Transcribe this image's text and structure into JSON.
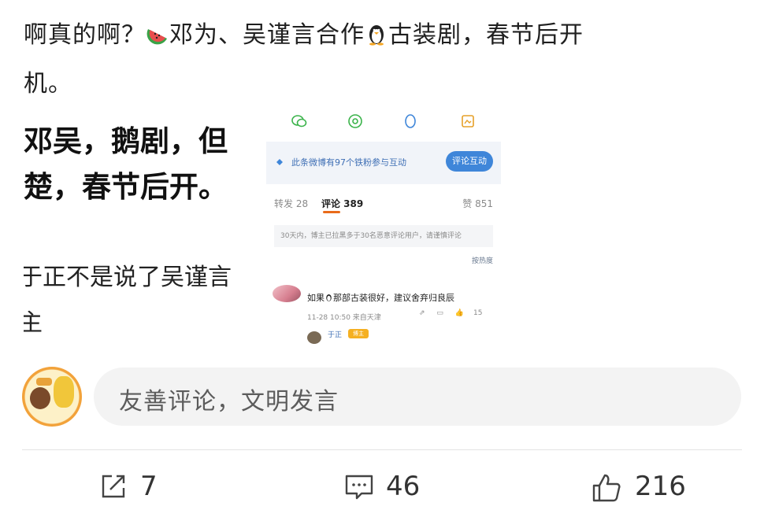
{
  "post": {
    "headline_part1": "啊真的啊？",
    "headline_part2": "邓为、吴谨言合作",
    "headline_part3": "古装剧，春节后开",
    "headline_part4": "机。"
  },
  "image_left": {
    "line1": "邓吴，鹅剧，但",
    "line2": "楚，春节后开。",
    "line3": "于正不是说了吴谨言",
    "line4": "主"
  },
  "image_right": {
    "interaction_text": "此条微博有97个铁粉参与互动",
    "interaction_button": "评论互动",
    "tab_repost": "转发 28",
    "tab_comment": "评论 389",
    "tab_like": "赞 851",
    "notice": "30天内，博主已拉黑多于30名恶意评论用户，请谨慎评论",
    "sort_label": "按热度",
    "comment_text_a": "如果",
    "comment_text_b": "那部古装很好，建议舍弃归良辰",
    "comment_time": "11-28 10:50  来自天津",
    "comment_likes": "15",
    "reply_name": "于正",
    "reply_badge": "博主"
  },
  "compose": {
    "placeholder": "友善评论，文明发言"
  },
  "actions": {
    "share_count": "7",
    "comment_count": "46",
    "like_count": "216"
  },
  "colors": {
    "accent_blue": "#3f86d9",
    "tab_underline": "#e96b1a"
  }
}
